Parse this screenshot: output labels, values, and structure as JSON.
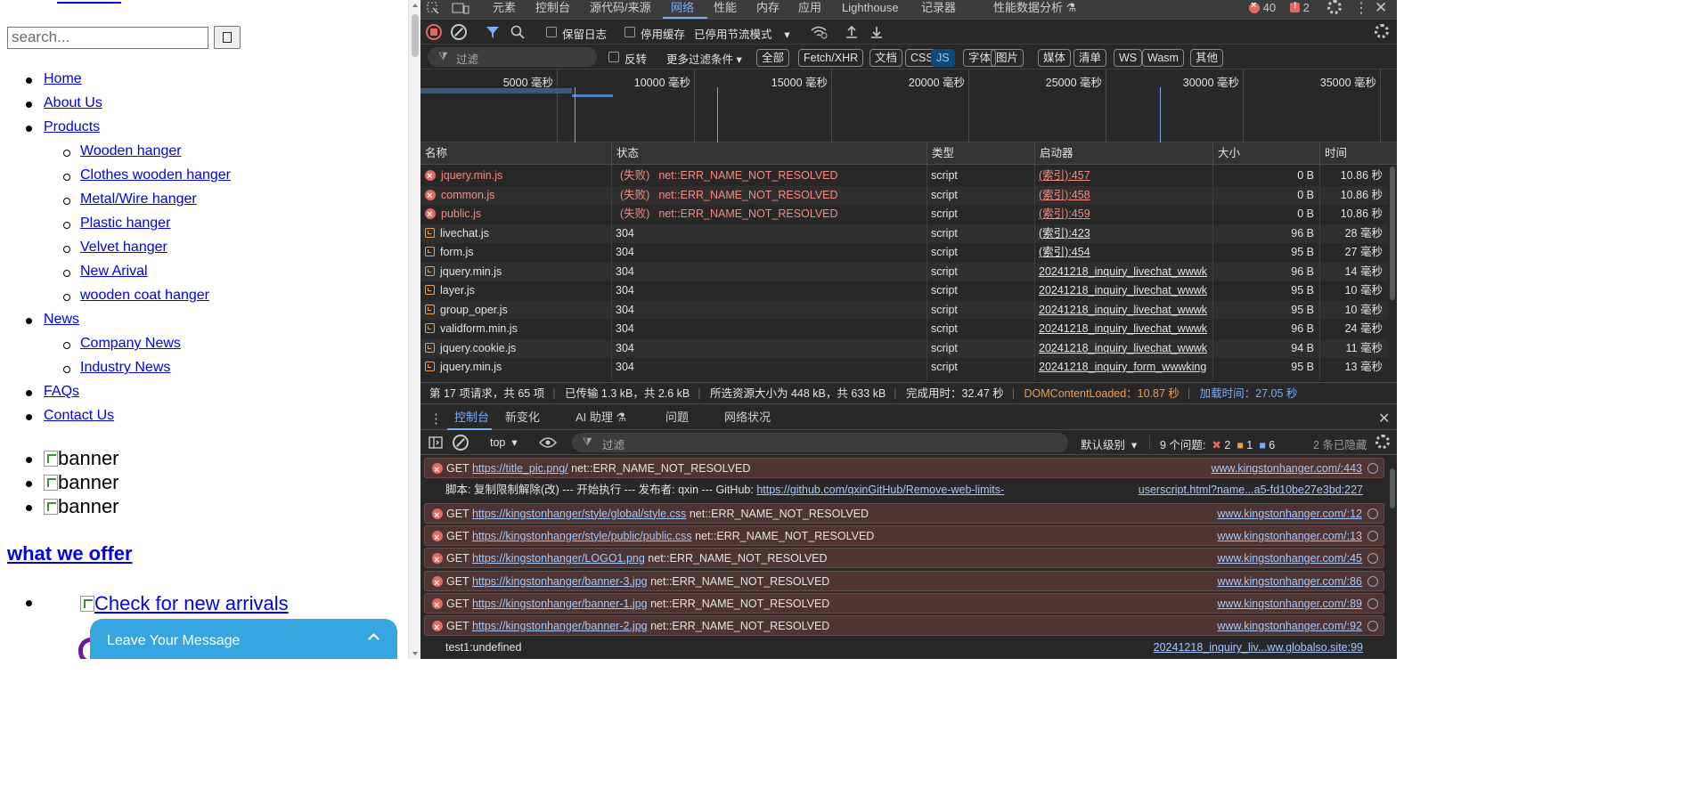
{
  "page": {
    "search_placeholder": "search...",
    "nav": [
      {
        "label": "Home",
        "level": 1
      },
      {
        "label": "About Us",
        "level": 1
      },
      {
        "label": "Products",
        "level": 1
      },
      {
        "label": "Wooden hanger",
        "level": 2
      },
      {
        "label": "Clothes wooden hanger",
        "level": 2
      },
      {
        "label": "Metal/Wire hanger",
        "level": 2
      },
      {
        "label": "Plastic hanger",
        "level": 2
      },
      {
        "label": "Velvet hanger",
        "level": 2
      },
      {
        "label": "New Arival",
        "level": 2
      },
      {
        "label": "wooden coat hanger",
        "level": 2
      },
      {
        "label": "News",
        "level": 1
      },
      {
        "label": "Company News",
        "level": 2
      },
      {
        "label": "Industry News",
        "level": 2
      },
      {
        "label": "FAQs",
        "level": 1
      },
      {
        "label": "Contact Us",
        "level": 1
      }
    ],
    "banners": [
      "banner",
      "banner",
      "banner"
    ],
    "section_heading": "what we offer",
    "offer_link": "Check for new arrivals",
    "leave_message": "Leave Your Message"
  },
  "devtools": {
    "tabs": [
      "元素",
      "控制台",
      "源代码/来源",
      "网络",
      "性能",
      "内存",
      "应用",
      "Lighthouse",
      "记录器",
      "性能数据分析 ⚗"
    ],
    "active_tab": "网络",
    "error_count": "40",
    "warning_count": "2",
    "toolbar": {
      "preserve_log": "保留日志",
      "disable_cache": "停用缓存",
      "throttle": "已停用节流模式"
    },
    "filter": {
      "placeholder": "过滤",
      "invert": "反转",
      "more_filters": "更多过滤条件",
      "types": [
        "全部",
        "Fetch/XHR",
        "文档",
        "CSS",
        "JS",
        "字体",
        "图片",
        "媒体",
        "清单",
        "WS",
        "Wasm",
        "其他"
      ],
      "active_type": "JS"
    },
    "timeline_ticks": [
      "5000 毫秒",
      "10000 毫秒",
      "15000 毫秒",
      "20000 毫秒",
      "25000 毫秒",
      "30000 毫秒",
      "35000 毫秒"
    ],
    "columns": [
      "名称",
      "状态",
      "类型",
      "启动器",
      "大小",
      "时间"
    ],
    "requests": [
      {
        "name": "jquery.min.js",
        "status": "(失败)",
        "status_text": "net::ERR_NAME_NOT_RESOLVED",
        "type": "script",
        "initiator": "(索引):457",
        "size": "0 B",
        "time": "10.86 秒",
        "failed": true
      },
      {
        "name": "common.js",
        "status": "(失败)",
        "status_text": "net::ERR_NAME_NOT_RESOLVED",
        "type": "script",
        "initiator": "(索引):458",
        "size": "0 B",
        "time": "10.86 秒",
        "failed": true
      },
      {
        "name": "public.js",
        "status": "(失败)",
        "status_text": "net::ERR_NAME_NOT_RESOLVED",
        "type": "script",
        "initiator": "(索引):459",
        "size": "0 B",
        "time": "10.86 秒",
        "failed": true
      },
      {
        "name": "livechat.js",
        "status": "304",
        "status_text": "",
        "type": "script",
        "initiator": "(索引):423",
        "size": "96 B",
        "time": "28 毫秒",
        "failed": false
      },
      {
        "name": "form.js",
        "status": "304",
        "status_text": "",
        "type": "script",
        "initiator": "(索引):454",
        "size": "95 B",
        "time": "27 毫秒",
        "failed": false
      },
      {
        "name": "jquery.min.js",
        "status": "304",
        "status_text": "",
        "type": "script",
        "initiator": "20241218_inquiry_livechat_wwwk",
        "size": "96 B",
        "time": "14 毫秒",
        "failed": false
      },
      {
        "name": "layer.js",
        "status": "304",
        "status_text": "",
        "type": "script",
        "initiator": "20241218_inquiry_livechat_wwwk",
        "size": "95 B",
        "time": "10 毫秒",
        "failed": false
      },
      {
        "name": "group_oper.js",
        "status": "304",
        "status_text": "",
        "type": "script",
        "initiator": "20241218_inquiry_livechat_wwwk",
        "size": "95 B",
        "time": "10 毫秒",
        "failed": false
      },
      {
        "name": "validform.min.js",
        "status": "304",
        "status_text": "",
        "type": "script",
        "initiator": "20241218_inquiry_livechat_wwwk",
        "size": "96 B",
        "time": "24 毫秒",
        "failed": false
      },
      {
        "name": "jquery.cookie.js",
        "status": "304",
        "status_text": "",
        "type": "script",
        "initiator": "20241218_inquiry_livechat_wwwk",
        "size": "94 B",
        "time": "11 毫秒",
        "failed": false
      },
      {
        "name": "jquery.min.js",
        "status": "304",
        "status_text": "",
        "type": "script",
        "initiator": "20241218_inquiry_form_wwwking",
        "size": "95 B",
        "time": "13 毫秒",
        "failed": false
      }
    ],
    "summary": {
      "requests": "第 17 项请求，共 65 项",
      "transferred": "已传输 1.3 kB，共 2.6 kB",
      "resources": "所选资源大小为 448 kB，共 633 kB",
      "finish": "完成用时：32.47 秒",
      "dcl": "DOMContentLoaded：10.87 秒",
      "load": "加载时间：27.05 秒"
    },
    "drawer": {
      "tabs": [
        "控制台",
        "新变化",
        "AI 助理 ⚗",
        "问题",
        "网络状况"
      ],
      "context": "top",
      "filter_placeholder": "过滤",
      "level": "默认级别",
      "issues_label": "9 个问题:",
      "issues_err": "2",
      "issues_warn": "1",
      "issues_info": "6",
      "hidden": "2 条已隐藏"
    },
    "console": [
      {
        "kind": "error",
        "prefix": "GET ",
        "link": "https://title_pic.png/",
        "suffix": " net::ERR_NAME_NOT_RESOLVED",
        "source": "www.kingstonhanger.com/:443"
      },
      {
        "kind": "log",
        "prefix": "脚本: 复制限制解除(改) --- 开始执行 --- 发布者: qxin --- GitHub: ",
        "link": "https://github.com/qxinGitHub/Remove-web-limits-",
        "suffix": "",
        "source": "userscript.html?name...a5-fd10be27e3bd:227"
      },
      {
        "kind": "error",
        "prefix": "GET ",
        "link": "https://kingstonhanger/style/global/style.css",
        "suffix": " net::ERR_NAME_NOT_RESOLVED",
        "source": "www.kingstonhanger.com/:12"
      },
      {
        "kind": "error",
        "prefix": "GET ",
        "link": "https://kingstonhanger/style/public/public.css",
        "suffix": " net::ERR_NAME_NOT_RESOLVED",
        "source": "www.kingstonhanger.com/:13"
      },
      {
        "kind": "error",
        "prefix": "GET ",
        "link": "https://kingstonhanger/LOGO1.png",
        "suffix": " net::ERR_NAME_NOT_RESOLVED",
        "source": "www.kingstonhanger.com/:45"
      },
      {
        "kind": "error",
        "prefix": "GET ",
        "link": "https://kingstonhanger/banner-3.jpg",
        "suffix": " net::ERR_NAME_NOT_RESOLVED",
        "source": "www.kingstonhanger.com/:86"
      },
      {
        "kind": "error",
        "prefix": "GET ",
        "link": "https://kingstonhanger/banner-1.jpg",
        "suffix": " net::ERR_NAME_NOT_RESOLVED",
        "source": "www.kingstonhanger.com/:89"
      },
      {
        "kind": "error",
        "prefix": "GET ",
        "link": "https://kingstonhanger/banner-2.jpg",
        "suffix": " net::ERR_NAME_NOT_RESOLVED",
        "source": "www.kingstonhanger.com/:92"
      },
      {
        "kind": "log",
        "prefix": "test1:undefined",
        "link": "",
        "suffix": "",
        "source": "20241218_inquiry_liv...ww.globalso.site:99"
      }
    ]
  }
}
